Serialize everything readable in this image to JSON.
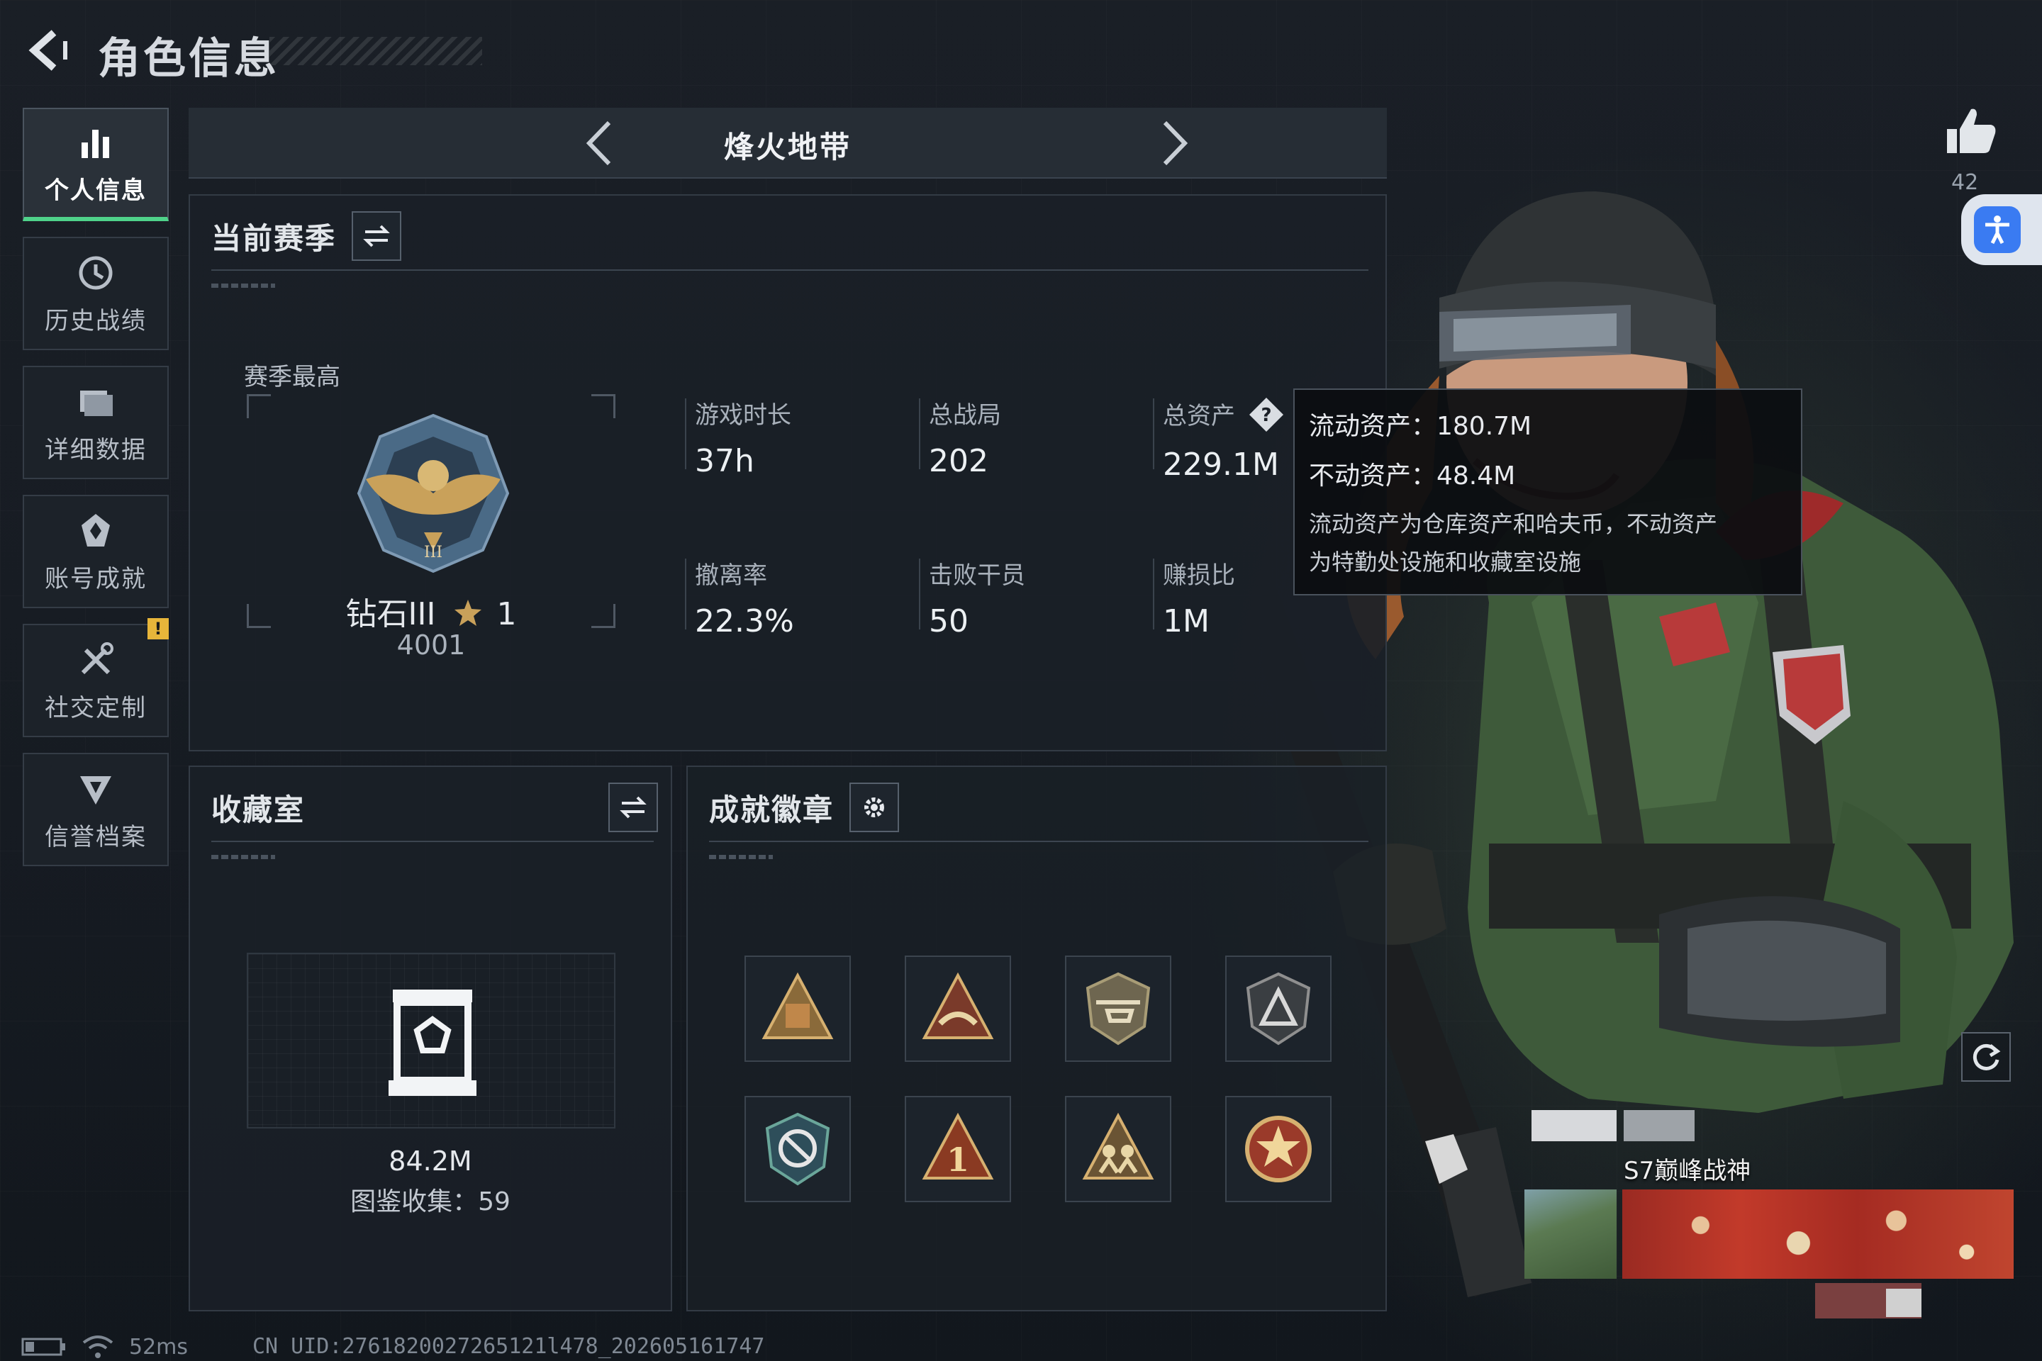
{
  "header": {
    "title": "角色信息"
  },
  "sidebar": {
    "items": [
      {
        "label": "个人信息",
        "icon": "bar-chart-icon",
        "active": true
      },
      {
        "label": "历史战绩",
        "icon": "history-icon"
      },
      {
        "label": "详细数据",
        "icon": "folder-icon"
      },
      {
        "label": "账号成就",
        "icon": "achievement-icon"
      },
      {
        "label": "社交定制",
        "icon": "tools-icon",
        "badge": "!"
      },
      {
        "label": "信誉档案",
        "icon": "credit-icon"
      }
    ]
  },
  "mode": {
    "title": "烽火地带"
  },
  "season": {
    "title": "当前赛季",
    "best_label": "赛季最高",
    "rank_name": "钻石III",
    "rank_stars": "1",
    "rank_score": "4001",
    "stats": [
      {
        "key": "游戏时长",
        "value": "37h"
      },
      {
        "key": "总战局",
        "value": "202"
      },
      {
        "key": "总资产",
        "value": "229.1M"
      },
      {
        "key": "撤离率",
        "value": "22.3%"
      },
      {
        "key": "击败干员",
        "value": "50"
      },
      {
        "key": "赚损比",
        "value": "1M"
      }
    ]
  },
  "tooltip": {
    "liquid": "流动资产：180.7M",
    "fixed": "不动资产：48.4M",
    "desc_line1": "流动资产为仓库资产和哈夫币，不动资产",
    "desc_line2": "为特勤处设施和收藏室设施"
  },
  "collection": {
    "title": "收藏室",
    "value": "84.2M",
    "count": "图鉴收集：59"
  },
  "badges": {
    "title": "成就徽章"
  },
  "social": {
    "likes": "42"
  },
  "title_card": {
    "label": "S7巅峰战神"
  },
  "status": {
    "ping": "52ms",
    "uid": "CN UID:2761820027265121l478_202605161747"
  },
  "colors": {
    "accent": "#4fd28a",
    "warning": "#e7b53a",
    "a11y": "#3a7bf2"
  }
}
